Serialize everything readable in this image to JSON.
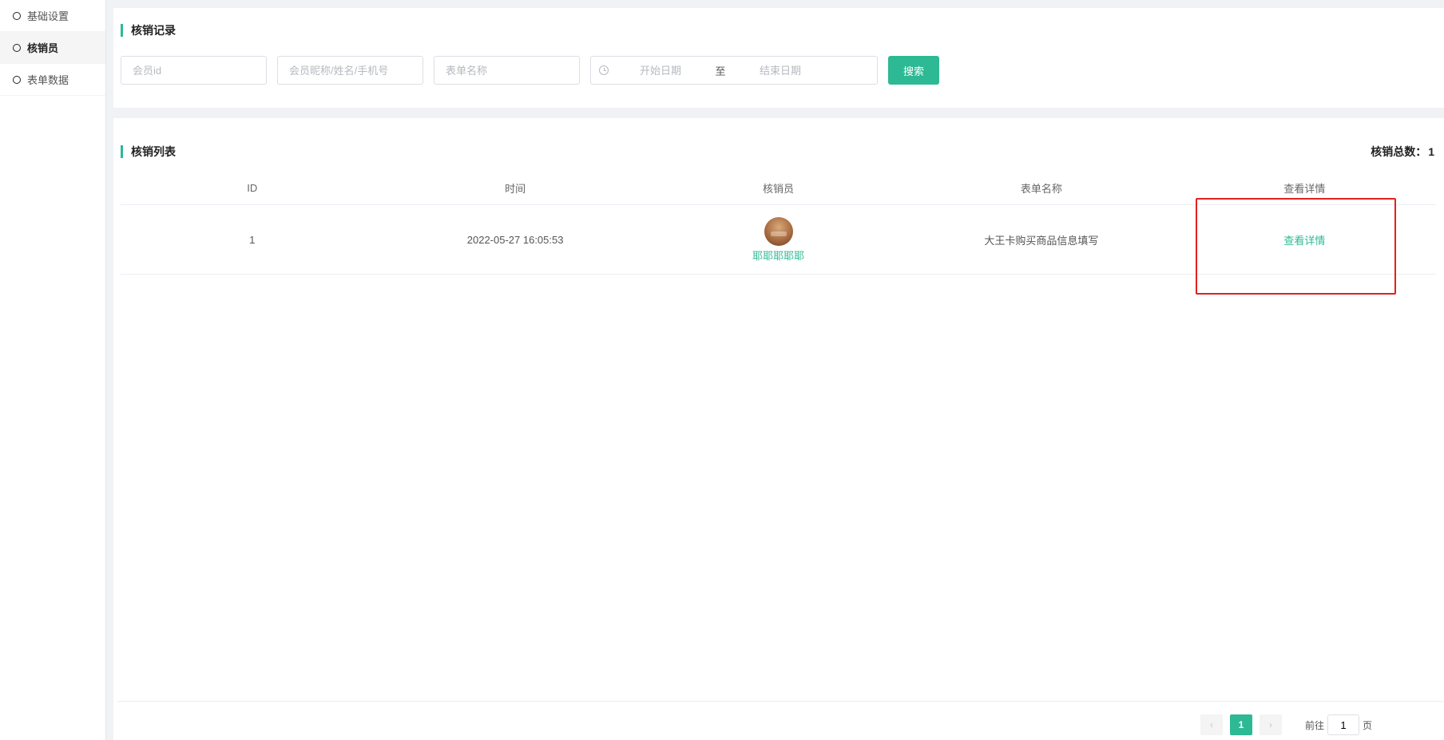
{
  "sidebar": {
    "items": [
      {
        "label": "基础设置"
      },
      {
        "label": "核销员"
      },
      {
        "label": "表单数据"
      }
    ]
  },
  "records": {
    "title": "核销记录",
    "member_id_placeholder": "会员id",
    "member_info_placeholder": "会员昵称/姓名/手机号",
    "form_name_placeholder": "表单名称",
    "start_date_placeholder": "开始日期",
    "date_separator": "至",
    "end_date_placeholder": "结束日期",
    "search_label": "搜索"
  },
  "list": {
    "title": "核销列表",
    "total_label": "核销总数：",
    "total_value": "1",
    "columns": [
      "ID",
      "时间",
      "核销员",
      "表单名称",
      "查看详情"
    ],
    "rows": [
      {
        "id": "1",
        "time": "2022-05-27 16:05:53",
        "verifier": "耶耶耶耶耶",
        "form_name": "大王卡购买商品信息填写",
        "detail": "查看详情"
      }
    ]
  },
  "pagination": {
    "prev_icon": "‹",
    "current_page": "1",
    "next_icon": "›",
    "goto_label": "前往",
    "goto_value": "1",
    "page_suffix": "页"
  },
  "colors": {
    "accent": "#2db994",
    "highlight": "#e02020"
  }
}
